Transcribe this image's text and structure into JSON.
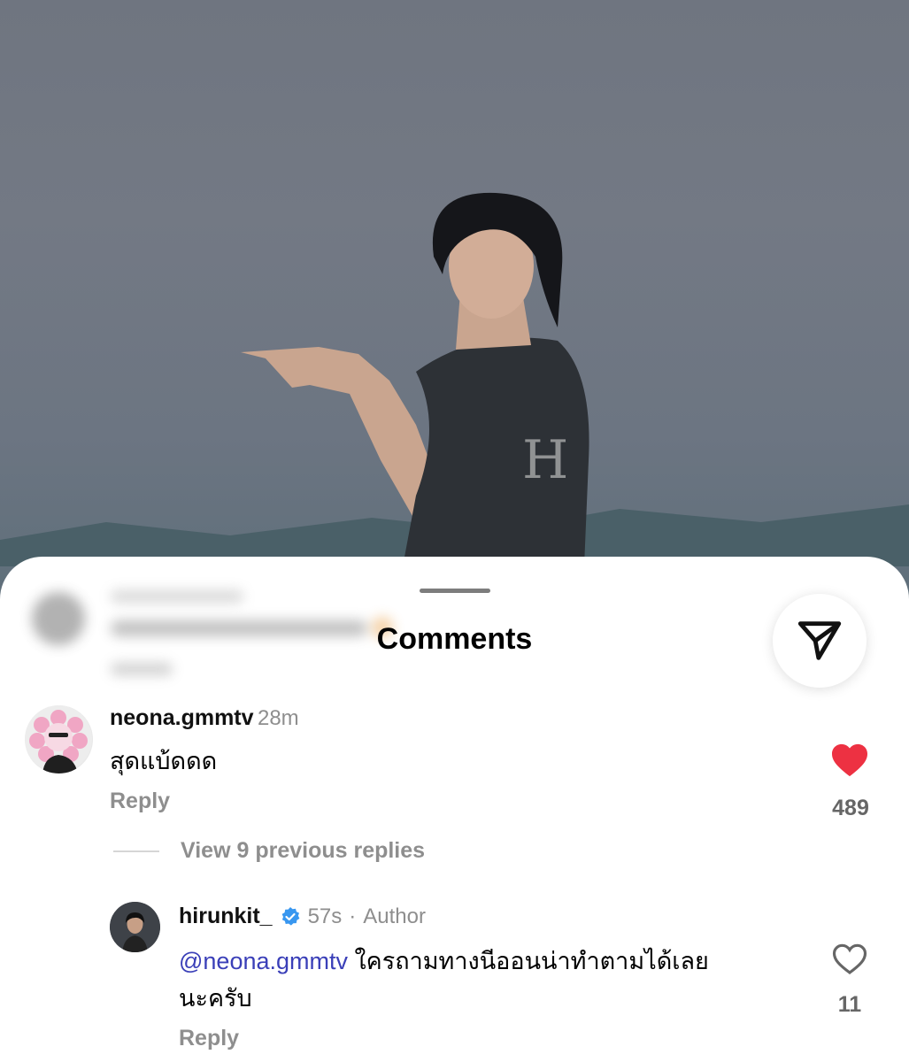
{
  "sheet": {
    "title": "Comments",
    "share_icon": "send-icon"
  },
  "comments": [
    {
      "username": "neona.gmmtv",
      "time": "28m",
      "text": "สุดแบ้ดดด",
      "reply_label": "Reply",
      "likes": "489",
      "liked": true
    }
  ],
  "view_replies": "View 9 previous replies",
  "replies": [
    {
      "username": "hirunkit_",
      "verified": true,
      "time": "57s",
      "separator": "·",
      "badge": "Author",
      "mention": "@neona.gmmtv",
      "text_line1": " ใครถามทางนีออนน่าทำตามได้เลย",
      "text_line2": "นะครับ",
      "reply_label": "Reply",
      "likes": "11",
      "liked": false
    }
  ],
  "colors": {
    "heart": "#ed3142",
    "mention": "#3a3fb8",
    "verified": "#3897f0"
  }
}
